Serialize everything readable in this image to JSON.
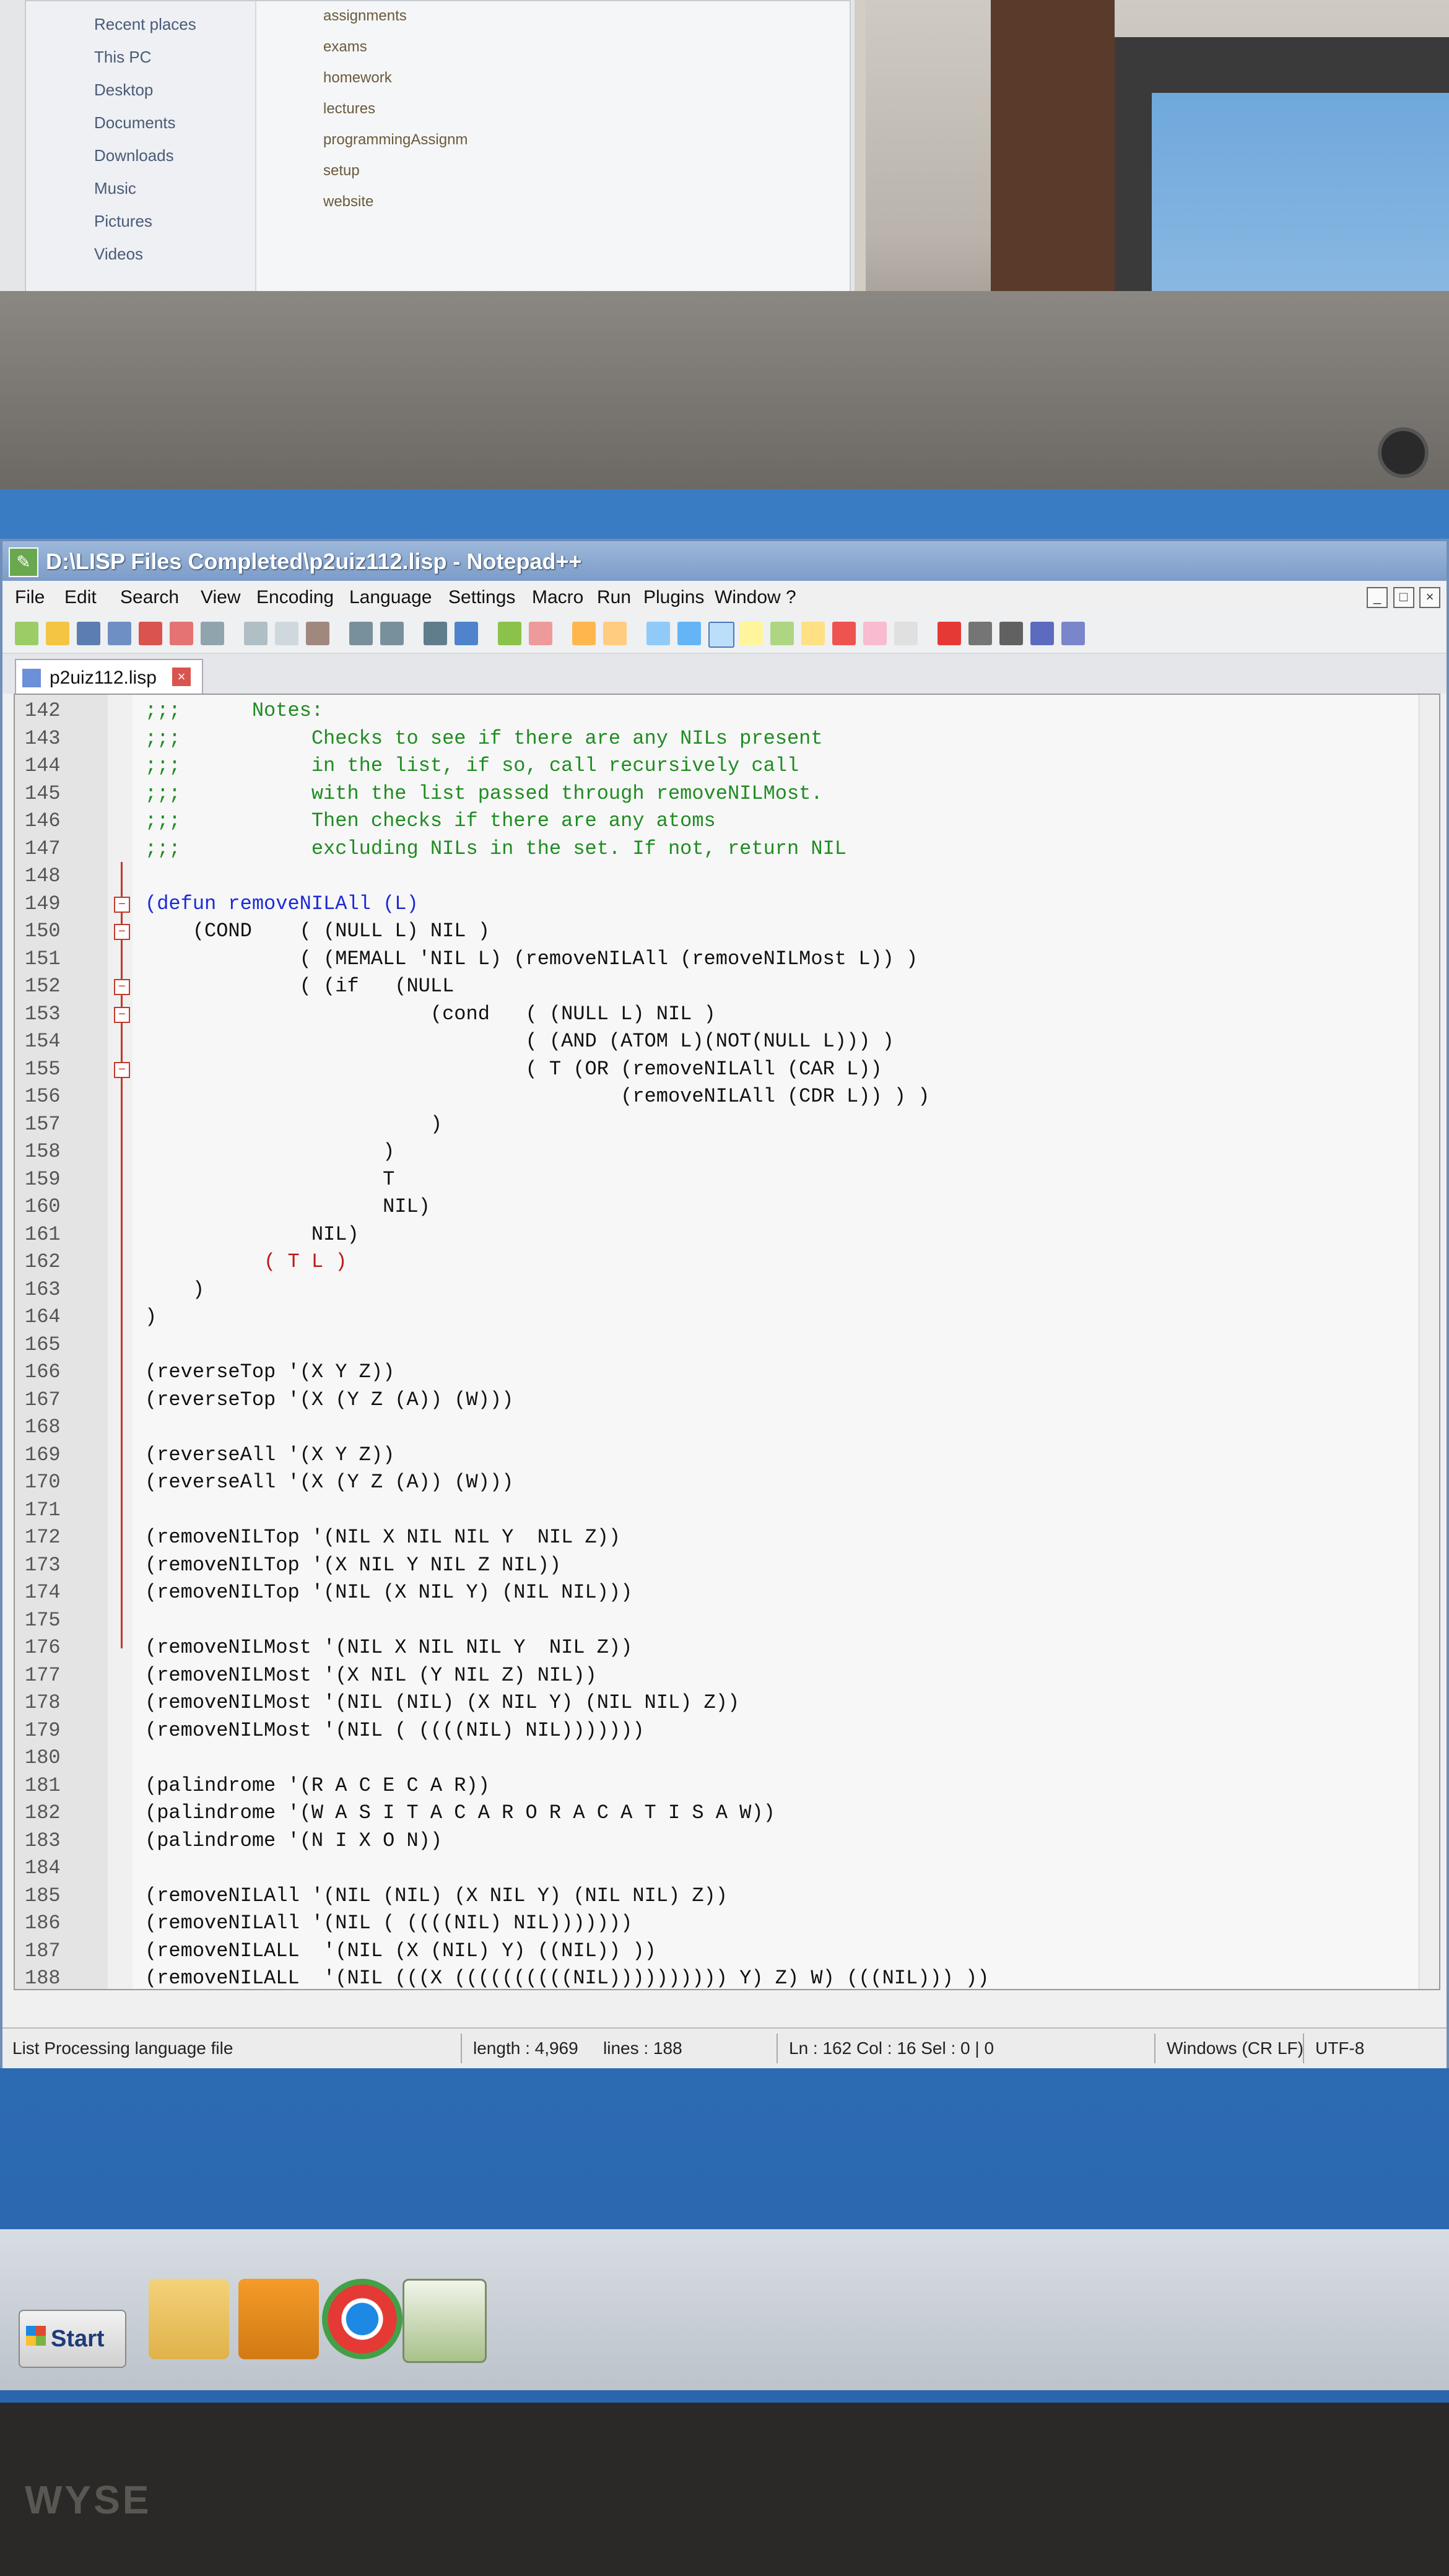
{
  "window": {
    "title": "D:\\LISP Files Completed\\p2uiz112.lisp - Notepad++"
  },
  "menu": [
    "File",
    "Edit",
    "Search",
    "View",
    "Encoding",
    "Language",
    "Settings",
    "Macro",
    "Run",
    "Plugins",
    "Window",
    "?"
  ],
  "tab": {
    "label": "p2uiz112.lisp"
  },
  "code_lines": [
    {
      "n": "142",
      "t": ";;;      Notes:",
      "c": "comment"
    },
    {
      "n": "143",
      "t": ";;;           Checks to see if there are any NILs present",
      "c": "comment"
    },
    {
      "n": "144",
      "t": ";;;           in the list, if so, call recursively call",
      "c": "comment"
    },
    {
      "n": "145",
      "t": ";;;           with the list passed through removeNILMost.",
      "c": "comment"
    },
    {
      "n": "146",
      "t": ";;;           Then checks if there are any atoms",
      "c": "comment"
    },
    {
      "n": "147",
      "t": ";;;           excluding NILs in the set. If not, return NIL",
      "c": "comment"
    },
    {
      "n": "148",
      "t": "",
      "c": ""
    },
    {
      "n": "149",
      "t": "(defun removeNILAll (L)",
      "c": "kw",
      "fold": "−"
    },
    {
      "n": "150",
      "t": "    (COND    ( (NULL L) NIL )",
      "c": "",
      "fold": "−"
    },
    {
      "n": "151",
      "t": "             ( (MEMALL 'NIL L) (removeNILAll (removeNILMost L)) )",
      "c": ""
    },
    {
      "n": "152",
      "t": "             ( (if   (NULL",
      "c": "",
      "fold": "−"
    },
    {
      "n": "153",
      "t": "                        (cond   ( (NULL L) NIL )",
      "c": "",
      "fold": "−"
    },
    {
      "n": "154",
      "t": "                                ( (AND (ATOM L)(NOT(NULL L))) )",
      "c": ""
    },
    {
      "n": "155",
      "t": "                                ( T (OR (removeNILAll (CAR L))",
      "c": "",
      "fold": "−"
    },
    {
      "n": "156",
      "t": "                                        (removeNILAll (CDR L)) ) )",
      "c": ""
    },
    {
      "n": "157",
      "t": "                        )",
      "c": ""
    },
    {
      "n": "158",
      "t": "                    )",
      "c": ""
    },
    {
      "n": "159",
      "t": "                    T",
      "c": ""
    },
    {
      "n": "160",
      "t": "                    NIL)",
      "c": ""
    },
    {
      "n": "161",
      "t": "              NIL)",
      "c": ""
    },
    {
      "n": "162",
      "t": "          ( T L )",
      "c": "kr"
    },
    {
      "n": "163",
      "t": "    )",
      "c": ""
    },
    {
      "n": "164",
      "t": ")",
      "c": ""
    },
    {
      "n": "165",
      "t": "",
      "c": ""
    },
    {
      "n": "166",
      "t": "(reverseTop '(X Y Z))",
      "c": ""
    },
    {
      "n": "167",
      "t": "(reverseTop '(X (Y Z (A)) (W)))",
      "c": ""
    },
    {
      "n": "168",
      "t": "",
      "c": ""
    },
    {
      "n": "169",
      "t": "(reverseAll '(X Y Z))",
      "c": ""
    },
    {
      "n": "170",
      "t": "(reverseAll '(X (Y Z (A)) (W)))",
      "c": ""
    },
    {
      "n": "171",
      "t": "",
      "c": ""
    },
    {
      "n": "172",
      "t": "(removeNILTop '(NIL X NIL NIL Y  NIL Z))",
      "c": ""
    },
    {
      "n": "173",
      "t": "(removeNILTop '(X NIL Y NIL Z NIL))",
      "c": ""
    },
    {
      "n": "174",
      "t": "(removeNILTop '(NIL (X NIL Y) (NIL NIL)))",
      "c": ""
    },
    {
      "n": "175",
      "t": "",
      "c": ""
    },
    {
      "n": "176",
      "t": "(removeNILMost '(NIL X NIL NIL Y  NIL Z))",
      "c": ""
    },
    {
      "n": "177",
      "t": "(removeNILMost '(X NIL (Y NIL Z) NIL))",
      "c": ""
    },
    {
      "n": "178",
      "t": "(removeNILMost '(NIL (NIL) (X NIL Y) (NIL NIL) Z))",
      "c": ""
    },
    {
      "n": "179",
      "t": "(removeNILMost '(NIL ( ((((NIL) NIL)))))))",
      "c": ""
    },
    {
      "n": "180",
      "t": "",
      "c": ""
    },
    {
      "n": "181",
      "t": "(palindrome '(R A C E C A R))",
      "c": ""
    },
    {
      "n": "182",
      "t": "(palindrome '(W A S I T A C A R O R A C A T I S A W))",
      "c": ""
    },
    {
      "n": "183",
      "t": "(palindrome '(N I X O N))",
      "c": ""
    },
    {
      "n": "184",
      "t": "",
      "c": ""
    },
    {
      "n": "185",
      "t": "(removeNILAll '(NIL (NIL) (X NIL Y) (NIL NIL) Z))",
      "c": ""
    },
    {
      "n": "186",
      "t": "(removeNILAll '(NIL ( ((((NIL) NIL)))))))",
      "c": ""
    },
    {
      "n": "187",
      "t": "(removeNILALL  '(NIL (X (NIL) Y) ((NIL)) ))",
      "c": ""
    },
    {
      "n": "188",
      "t": "(removeNILALL  '(NIL (((X ((((((((((NIL)))))))))) Y) Z) W) (((NIL))) ))",
      "c": ""
    }
  ],
  "status": {
    "file_type": "List Processing language file",
    "length": "length : 4,969",
    "lines": "lines : 188",
    "position": "Ln : 162   Col : 16   Sel : 0 | 0",
    "eol": "Windows (CR LF)",
    "encoding": "UTF-8"
  },
  "taskbar": {
    "start_label": "Start"
  },
  "bezel": {
    "brand": "WYSE"
  },
  "projection": {
    "nav_items": [
      "Recent places",
      "This PC",
      "Desktop",
      "Documents",
      "Downloads",
      "Music",
      "Pictures",
      "Videos"
    ],
    "folders": [
      "assignments",
      "exams",
      "homework",
      "lectures",
      "programmingAssignm",
      "setup",
      "website"
    ]
  }
}
